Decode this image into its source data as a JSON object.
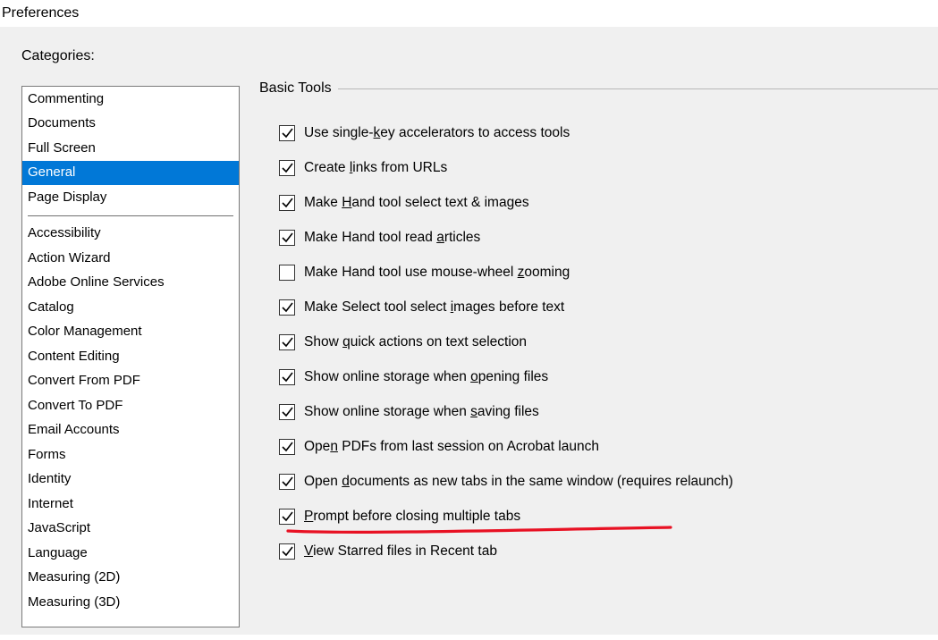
{
  "window": {
    "title": "Preferences"
  },
  "sidebar": {
    "label": "Categories:",
    "items_group1": [
      "Commenting",
      "Documents",
      "Full Screen",
      "General",
      "Page Display"
    ],
    "selected_index": 3,
    "items_group2": [
      "Accessibility",
      "Action Wizard",
      "Adobe Online Services",
      "Catalog",
      "Color Management",
      "Content Editing",
      "Convert From PDF",
      "Convert To PDF",
      "Email Accounts",
      "Forms",
      "Identity",
      "Internet",
      "JavaScript",
      "Language",
      "Measuring (2D)",
      "Measuring (3D)"
    ]
  },
  "group": {
    "title": "Basic Tools"
  },
  "options": [
    {
      "checked": true,
      "pre": "Use single-",
      "u": "k",
      "post": "ey accelerators to access tools"
    },
    {
      "checked": true,
      "pre": "Create ",
      "u": "l",
      "post": "inks from URLs"
    },
    {
      "checked": true,
      "pre": "Make ",
      "u": "H",
      "post": "and tool select text & images"
    },
    {
      "checked": true,
      "pre": "Make Hand tool read ",
      "u": "a",
      "post": "rticles"
    },
    {
      "checked": false,
      "pre": "Make Hand tool use mouse-wheel ",
      "u": "z",
      "post": "ooming"
    },
    {
      "checked": true,
      "pre": "Make Select tool select ",
      "u": "i",
      "post": "mages before text"
    },
    {
      "checked": true,
      "pre": "Show ",
      "u": "q",
      "post": "uick actions on text selection"
    },
    {
      "checked": true,
      "pre": "Show online storage when ",
      "u": "o",
      "post": "pening files"
    },
    {
      "checked": true,
      "pre": "Show online storage when ",
      "u": "s",
      "post": "aving files"
    },
    {
      "checked": true,
      "pre": "Ope",
      "u": "n",
      "post": " PDFs from last session on Acrobat launch"
    },
    {
      "checked": true,
      "pre": "Open ",
      "u": "d",
      "post": "ocuments as new tabs in the same window (requires relaunch)"
    },
    {
      "checked": true,
      "pre": "",
      "u": "P",
      "post": "rompt before closing multiple tabs"
    },
    {
      "checked": true,
      "pre": "",
      "u": "V",
      "post": "iew Starred files in Recent tab"
    }
  ],
  "annotation": {
    "color": "#e81123"
  }
}
